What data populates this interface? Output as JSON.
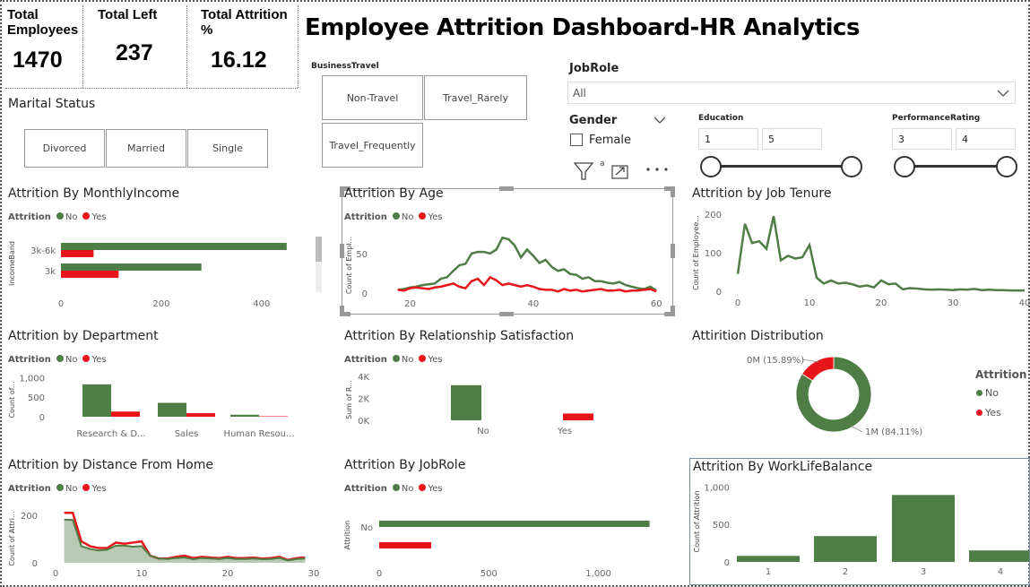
{
  "kpis": {
    "total_employees": {
      "label_line1": "Total",
      "label_line2": "Employees",
      "value": "1470"
    },
    "total_left": {
      "label": "Total Left",
      "value": "237"
    },
    "total_attrition": {
      "label_line1": "Total Attrition",
      "label_line2": "%",
      "value": "16.12"
    }
  },
  "dashboard_title": "Employee Attrition Dashboard-HR Analytics",
  "filters": {
    "marital_status": {
      "title": "Marital Status",
      "options": [
        "Divorced",
        "Married",
        "Single"
      ]
    },
    "business_travel": {
      "title": "BusinessTravel",
      "options": [
        "Non-Travel",
        "Travel_Rarely",
        "Travel_Frequently"
      ]
    },
    "job_role": {
      "title": "JobRole",
      "value": "All"
    },
    "gender": {
      "title": "Gender",
      "option": "Female"
    },
    "education": {
      "title": "Education",
      "min": "1",
      "max": "5"
    },
    "performance_rating": {
      "title": "PerformanceRating",
      "min": "3",
      "max": "4"
    },
    "visual_header_glyph": "a"
  },
  "legend": {
    "title": "Attrition",
    "no": "No",
    "yes": "Yes"
  },
  "colors": {
    "no": "#4e7d45",
    "yes": "#e8161b",
    "no_fill": "#b8c9b4"
  },
  "visuals": {
    "monthly_income": {
      "title": "Attrition By MonthlyIncome",
      "axis_title": "IncomeBand"
    },
    "age": {
      "title": "Attrition By Age",
      "axis_title": "Count of Empl..."
    },
    "tenure": {
      "title": "Attrition by Job Tenure",
      "axis_title": "Count of Employee..."
    },
    "department": {
      "title": "Attrition by Department",
      "axis_title": "Count of..."
    },
    "relationship": {
      "title": "Attrition By Relationship Satisfaction",
      "axis_title": "Sum of R..."
    },
    "distribution": {
      "title": "Attirition Distribution",
      "legend_title": "Attrition"
    },
    "distance": {
      "title": "Attrition by Distance From Home",
      "axis_title": "Count of Attri..."
    },
    "jobrole": {
      "title": "Attrition By JobRole",
      "axis_title": "Attrition"
    },
    "worklife": {
      "title": "Attrition By WorkLifeBalance",
      "axis_title": "Count of Attrition"
    }
  },
  "chart_data": [
    {
      "id": "monthly_income",
      "type": "bar",
      "orientation": "horizontal",
      "categories": [
        "3k-6k",
        "3k"
      ],
      "series": [
        {
          "name": "No",
          "values": [
            450,
            280
          ]
        },
        {
          "name": "Yes",
          "values": [
            65,
            115
          ]
        }
      ],
      "xlim": [
        0,
        470
      ],
      "xticks": [
        "0",
        "200",
        "400"
      ],
      "ylabel": "IncomeBand"
    },
    {
      "id": "age",
      "type": "line",
      "x": [
        18,
        19,
        20,
        21,
        22,
        23,
        24,
        25,
        26,
        27,
        28,
        29,
        30,
        31,
        32,
        33,
        34,
        35,
        36,
        37,
        38,
        39,
        40,
        41,
        42,
        43,
        44,
        45,
        46,
        47,
        48,
        49,
        50,
        51,
        52,
        53,
        54,
        55,
        56,
        57,
        58,
        59,
        60
      ],
      "series": [
        {
          "name": "No",
          "values": [
            4,
            5,
            7,
            8,
            10,
            11,
            12,
            18,
            20,
            28,
            35,
            37,
            50,
            52,
            52,
            50,
            55,
            70,
            68,
            60,
            45,
            55,
            47,
            38,
            42,
            33,
            28,
            30,
            24,
            23,
            18,
            20,
            15,
            15,
            13,
            12,
            14,
            10,
            8,
            6,
            5,
            8,
            3
          ]
        },
        {
          "name": "Yes",
          "values": [
            4,
            3,
            6,
            7,
            6,
            5,
            7,
            8,
            10,
            12,
            8,
            6,
            15,
            18,
            10,
            20,
            16,
            10,
            12,
            10,
            8,
            10,
            8,
            5,
            4,
            4,
            2,
            5,
            3,
            4,
            2,
            3,
            4,
            5,
            3,
            3,
            4,
            2,
            3,
            3,
            4,
            5,
            2
          ]
        }
      ],
      "xlim": [
        16,
        62
      ],
      "ylim": [
        -8,
        85
      ],
      "xticks": [
        "20",
        "40",
        "60"
      ],
      "yticks": [
        "0",
        "50"
      ]
    },
    {
      "id": "tenure",
      "type": "line",
      "x": [
        0,
        1,
        2,
        3,
        4,
        5,
        6,
        7,
        8,
        9,
        10,
        11,
        12,
        13,
        14,
        15,
        16,
        17,
        18,
        19,
        20,
        21,
        22,
        23,
        24,
        25,
        26,
        27,
        28,
        29,
        30,
        31,
        32,
        33,
        34,
        35,
        36,
        37,
        38,
        39,
        40
      ],
      "series": [
        {
          "name": "No",
          "values": [
            45,
            175,
            125,
            130,
            110,
            195,
            80,
            92,
            85,
            88,
            120,
            35,
            20,
            28,
            20,
            22,
            18,
            12,
            15,
            10,
            28,
            18,
            20,
            5,
            8,
            7,
            5,
            4,
            5,
            4,
            3,
            5,
            4,
            6,
            3,
            4,
            3,
            3,
            2,
            2,
            2
          ]
        }
      ],
      "xlim": [
        -1,
        40
      ],
      "ylim": [
        0,
        200
      ],
      "xticks": [
        "0",
        "10",
        "20",
        "30",
        "40"
      ],
      "yticks": [
        "0",
        "100",
        "200"
      ]
    },
    {
      "id": "department",
      "type": "bar",
      "categories": [
        "Research & D...",
        "Sales",
        "Human Resou..."
      ],
      "series": [
        {
          "name": "No",
          "values": [
            828,
            354,
            51
          ]
        },
        {
          "name": "Yes",
          "values": [
            133,
            92,
            12
          ]
        }
      ],
      "ylim": [
        0,
        1100
      ],
      "yticks": [
        "0",
        "500",
        "1,000"
      ]
    },
    {
      "id": "relationship",
      "type": "bar",
      "categories": [
        "No",
        "Yes"
      ],
      "values": [
        3200,
        620
      ],
      "ylim": [
        0,
        4000
      ],
      "yticks": [
        "0K",
        "2K",
        "4K"
      ]
    },
    {
      "id": "distribution",
      "type": "pie",
      "variant": "donut",
      "categories": [
        "No",
        "Yes"
      ],
      "values": [
        84.11,
        15.89
      ],
      "labels": [
        "1M (84.11%)",
        "0M (15.89%)"
      ]
    },
    {
      "id": "distance",
      "type": "area",
      "x": [
        1,
        2,
        3,
        4,
        5,
        6,
        7,
        8,
        9,
        10,
        11,
        12,
        13,
        14,
        15,
        16,
        17,
        18,
        19,
        20,
        21,
        22,
        23,
        24,
        25,
        26,
        27,
        28,
        29
      ],
      "series": [
        {
          "name": "No",
          "values": [
            182,
            180,
            70,
            58,
            52,
            55,
            72,
            72,
            68,
            70,
            30,
            18,
            16,
            20,
            22,
            15,
            20,
            18,
            16,
            20,
            16,
            16,
            18,
            15,
            16,
            20,
            10,
            16,
            18
          ]
        },
        {
          "name": "Yes",
          "values": [
            210,
            210,
            90,
            70,
            62,
            62,
            85,
            80,
            85,
            90,
            30,
            18,
            18,
            25,
            30,
            20,
            25,
            22,
            20,
            25,
            20,
            20,
            22,
            18,
            20,
            25,
            12,
            20,
            22
          ]
        }
      ],
      "xlim": [
        0,
        30
      ],
      "ylim": [
        0,
        260
      ],
      "xticks": [
        "0",
        "10",
        "20",
        "30"
      ],
      "yticks": [
        "0",
        "200"
      ]
    },
    {
      "id": "jobrole",
      "type": "bar",
      "orientation": "horizontal",
      "categories": [
        "No"
      ],
      "series": [
        {
          "name": "No",
          "values": [
            1233
          ]
        },
        {
          "name": "Yes",
          "values": [
            237
          ]
        }
      ],
      "xlim": [
        0,
        1300
      ],
      "xticks": [
        "0",
        "500",
        "1,000"
      ],
      "ylabel": "Attrition"
    },
    {
      "id": "worklife",
      "type": "bar",
      "categories": [
        "1",
        "2",
        "3",
        "4"
      ],
      "values": [
        80,
        344,
        893,
        153
      ],
      "ylim": [
        0,
        1100
      ],
      "yticks": [
        "0",
        "500",
        "1,000"
      ]
    }
  ]
}
